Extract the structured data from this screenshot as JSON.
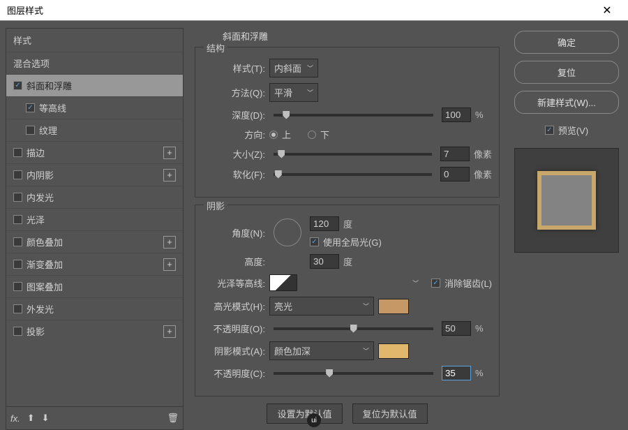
{
  "window": {
    "title": "图层样式"
  },
  "sidebar": {
    "header_styles": "样式",
    "header_blend": "混合选项",
    "items": [
      {
        "label": "斜面和浮雕",
        "checked": true,
        "selected": true,
        "plus": false
      },
      {
        "label": "等高线",
        "checked": true,
        "sub": true,
        "plus": false
      },
      {
        "label": "纹理",
        "checked": false,
        "sub": true,
        "plus": false
      },
      {
        "label": "描边",
        "checked": false,
        "plus": true
      },
      {
        "label": "内阴影",
        "checked": false,
        "plus": true
      },
      {
        "label": "内发光",
        "checked": false,
        "plus": false
      },
      {
        "label": "光泽",
        "checked": false,
        "plus": false
      },
      {
        "label": "颜色叠加",
        "checked": false,
        "plus": true
      },
      {
        "label": "渐变叠加",
        "checked": false,
        "plus": true
      },
      {
        "label": "图案叠加",
        "checked": false,
        "plus": false
      },
      {
        "label": "外发光",
        "checked": false,
        "plus": false
      },
      {
        "label": "投影",
        "checked": false,
        "plus": true
      }
    ],
    "footer_fx": "fx"
  },
  "center": {
    "title": "斜面和浮雕",
    "structure": {
      "legend": "结构",
      "style_label": "样式(T):",
      "style_value": "内斜面",
      "method_label": "方法(Q):",
      "method_value": "平滑",
      "depth_label": "深度(D):",
      "depth_value": "100",
      "depth_unit": "%",
      "direction_label": "方向:",
      "up": "上",
      "down": "下",
      "size_label": "大小(Z):",
      "size_value": "7",
      "size_unit": "像素",
      "soften_label": "软化(F):",
      "soften_value": "0",
      "soften_unit": "像素"
    },
    "shadow": {
      "legend": "阴影",
      "angle_label": "角度(N):",
      "angle_value": "120",
      "angle_unit": "度",
      "global_label": "使用全局光(G)",
      "altitude_label": "高度:",
      "altitude_value": "30",
      "altitude_unit": "度",
      "gloss_label": "光泽等高线:",
      "antialias_label": "消除锯齿(L)",
      "highlight_mode_label": "高光模式(H):",
      "highlight_mode_value": "亮光",
      "highlight_color": "#c59866",
      "highlight_opacity_label": "不透明度(O):",
      "highlight_opacity_value": "50",
      "opacity_unit": "%",
      "shadow_mode_label": "阴影模式(A):",
      "shadow_mode_value": "颜色加深",
      "shadow_color": "#e0b76c",
      "shadow_opacity_label": "不透明度(C):",
      "shadow_opacity_value": "35"
    },
    "buttons": {
      "default": "设置为默认值",
      "reset": "复位为默认值"
    }
  },
  "right": {
    "ok": "确定",
    "cancel": "复位",
    "new_style": "新建样式(W)...",
    "preview_label": "预览(V)"
  }
}
